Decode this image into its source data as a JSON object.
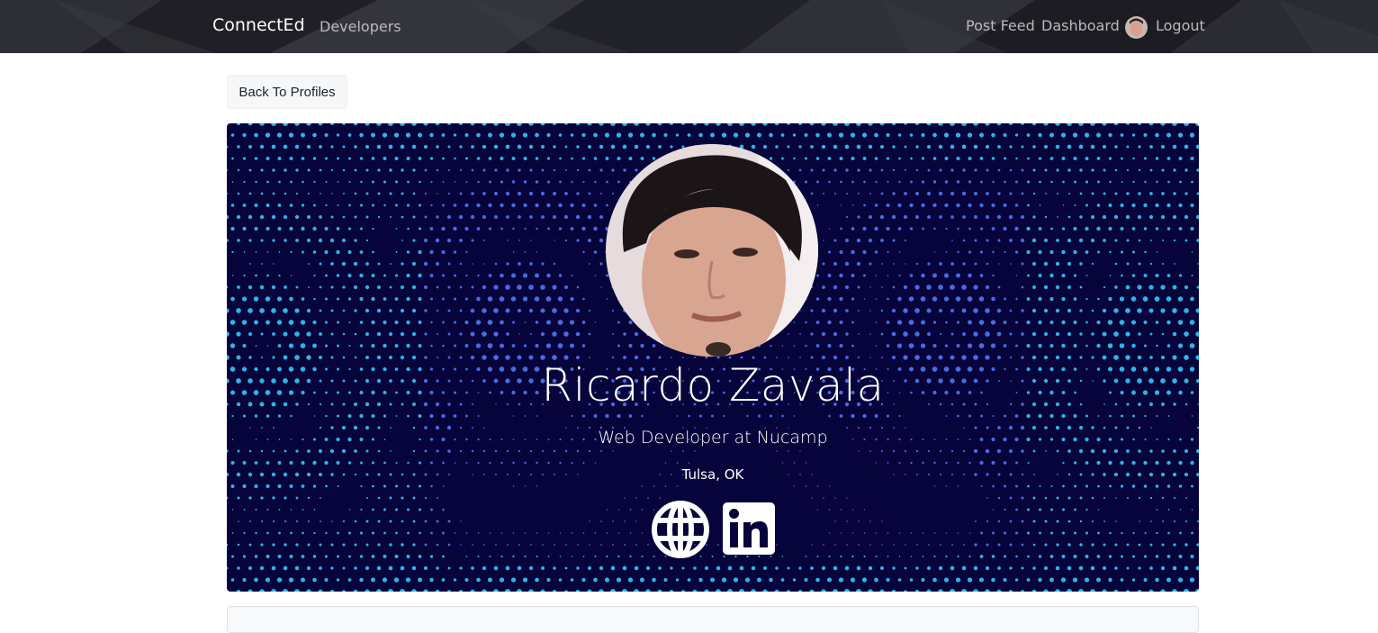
{
  "navbar": {
    "brand": "ConnectEd",
    "developers_label": "Developers",
    "post_feed_label": "Post Feed",
    "dashboard_label": "Dashboard",
    "logout_label": "Logout"
  },
  "back_button": {
    "label": "Back To Profiles"
  },
  "profile": {
    "name": "Ricardo Zavala",
    "status": "Web Developer at Nucamp",
    "location": "Tulsa, OK",
    "social": [
      {
        "icon": "globe-icon"
      },
      {
        "icon": "linkedin-icon"
      }
    ]
  },
  "colors": {
    "navbar_bg": "#24242b",
    "hero_bg": "#06043a",
    "dot_cyan": "#2ab6e8",
    "dot_blue": "#4a6be0",
    "dot_purple": "#7a3ce0"
  }
}
